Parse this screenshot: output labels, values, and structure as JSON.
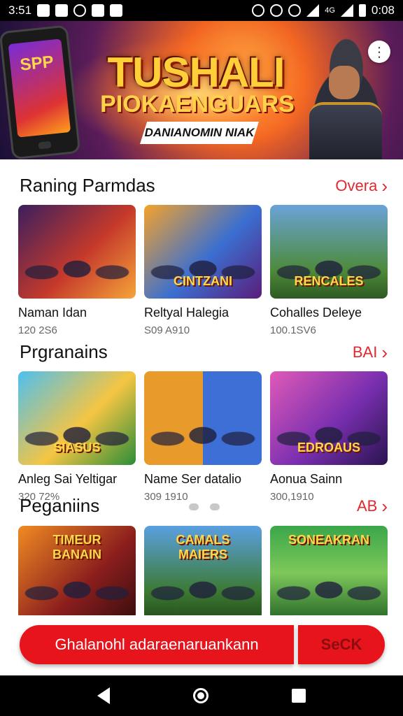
{
  "status_bar": {
    "time": "3:51",
    "clock_right": "0:08",
    "net_label": "4G"
  },
  "hero": {
    "title": "TUSHALI",
    "subtitle": "PIOKAENGUARS",
    "tagline": "DANIANOMIN NIAK",
    "phone_screen": "SPP"
  },
  "sections": [
    {
      "title": "Raning Parmdas",
      "link": "Overa",
      "items": [
        {
          "title": "Naman Idan",
          "meta": "120 2S6",
          "thumb_label": ""
        },
        {
          "title": "Reltyal Halegia",
          "meta": "S09 A910",
          "thumb_label": "CINTZANI"
        },
        {
          "title": "Cohalles Deleye",
          "meta": "100.1SV6",
          "thumb_label": "RENCALES"
        }
      ]
    },
    {
      "title": "Prgranains",
      "link": "BAI",
      "items": [
        {
          "title": "Anleg Sai Yeltigar",
          "meta": "320 72%",
          "thumb_label": "SIASUS"
        },
        {
          "title": "Name Ser datalio",
          "meta": "309 1910",
          "thumb_label": ""
        },
        {
          "title": "Aonua Sainn",
          "meta": "300,1910",
          "thumb_label": "EDROAUS"
        }
      ]
    },
    {
      "title": "Peganiins",
      "link": "AB",
      "items": [
        {
          "title": "",
          "meta": "",
          "thumb_label": "TIMEUR BANAIN"
        },
        {
          "title": "",
          "meta": "",
          "thumb_label": "CAMALS MAIERS"
        },
        {
          "title": "",
          "meta": "",
          "thumb_label": "SONEAKRAN"
        }
      ]
    }
  ],
  "cta": {
    "primary": "Ghalanohl adaraenaruankann",
    "secondary": "SeCK"
  }
}
